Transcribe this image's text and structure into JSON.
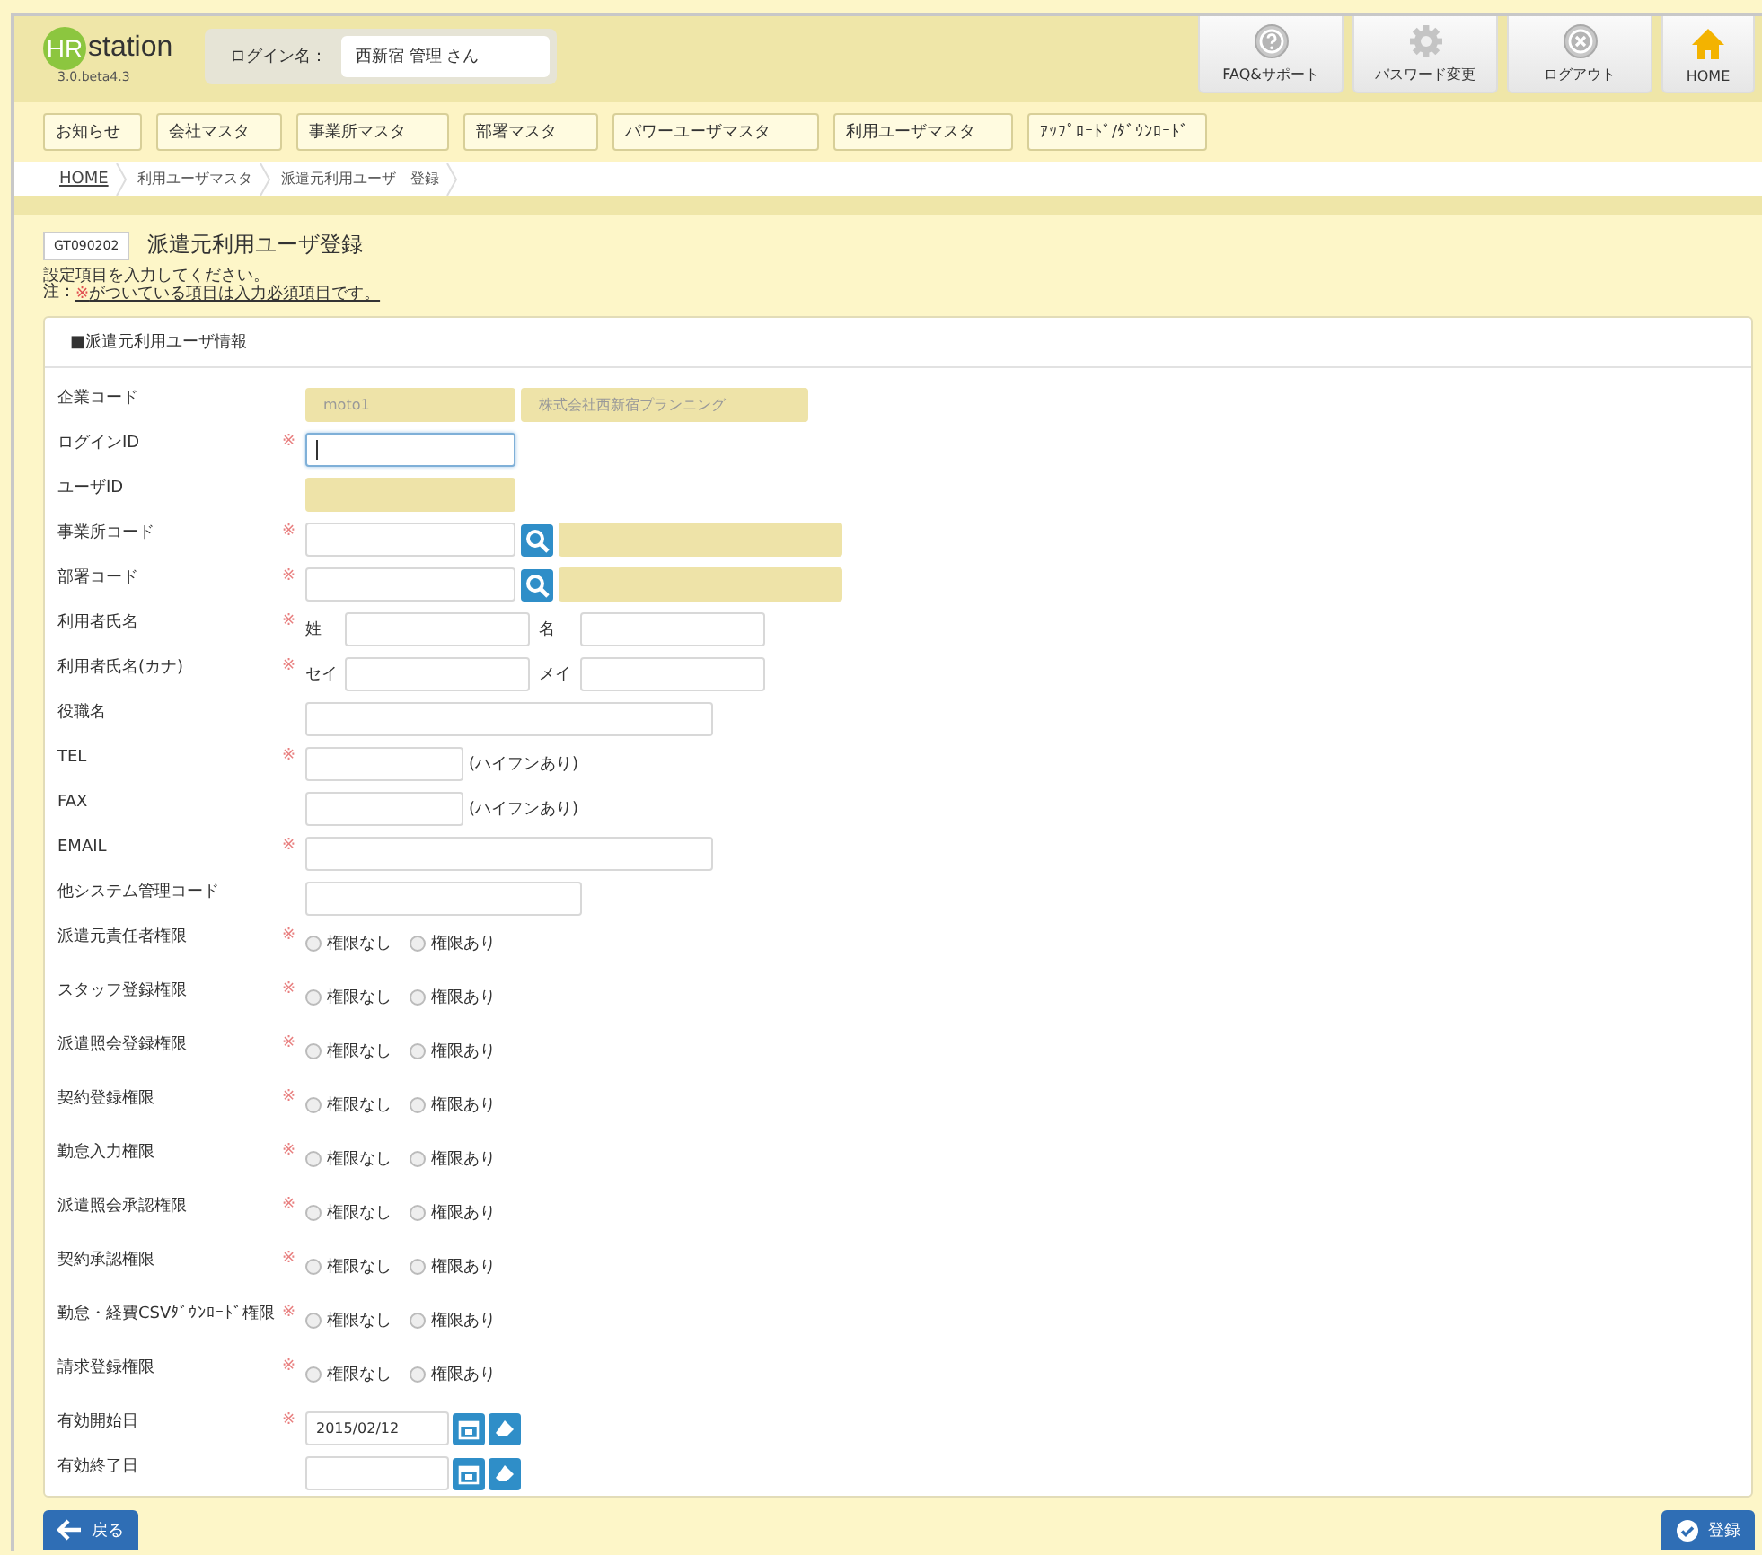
{
  "header": {
    "logo": {
      "mark": "HR",
      "name": "station",
      "version": "3.0.beta4.3"
    },
    "login_label": "ログイン名：",
    "login_user": "西新宿 管理 さん",
    "actions": [
      {
        "kind": "help",
        "label": "FAQ&サポート"
      },
      {
        "kind": "settings",
        "label": "パスワード変更"
      },
      {
        "kind": "logout",
        "label": "ログアウト"
      },
      {
        "kind": "home",
        "label": "HOME"
      }
    ]
  },
  "nav": [
    "お知らせ",
    "会社マスタ",
    "事業所マスタ",
    "部署マスタ",
    "パワーユーザマスタ",
    "利用ユーザマスタ",
    "ｱｯﾌﾟﾛｰﾄﾞ/ﾀﾞｳﾝﾛｰﾄﾞ"
  ],
  "breadcrumb": [
    {
      "label": "HOME",
      "link": true
    },
    {
      "label": "利用ユーザマスタ",
      "link": false
    },
    {
      "label": "派遣元利用ユーザ　登録",
      "link": false
    }
  ],
  "page": {
    "code": "GT090202",
    "title": "派遣元利用ユーザ登録",
    "instruction": "設定項目を入力してください。",
    "note_prefix": "注：",
    "note_mark": "※",
    "note": "がついている項目は入力必須項目です。"
  },
  "form": {
    "title": "■派遣元利用ユーザ情報",
    "required_mark": "※",
    "rows": [
      {
        "label": "企業コード",
        "required": false,
        "kind": "readonly-pair",
        "values": [
          "moto1",
          "株式会社西新宿プランニング"
        ]
      },
      {
        "label": "ログインID",
        "required": true,
        "kind": "input",
        "focused": true
      },
      {
        "label": "ユーザID",
        "required": false,
        "kind": "readonly"
      },
      {
        "label": "事業所コード",
        "required": true,
        "kind": "lookup"
      },
      {
        "label": "部署コード",
        "required": true,
        "kind": "lookup"
      },
      {
        "label": "利用者氏名",
        "required": true,
        "kind": "name",
        "parts": [
          "姓",
          "名"
        ]
      },
      {
        "label": "利用者氏名(カナ)",
        "required": true,
        "kind": "name",
        "parts": [
          "セイ",
          "メイ"
        ]
      },
      {
        "label": "役職名",
        "required": false,
        "kind": "wide"
      },
      {
        "label": "TEL",
        "required": true,
        "kind": "phone",
        "note": "(ハイフンあり)"
      },
      {
        "label": "FAX",
        "required": false,
        "kind": "phone",
        "note": "(ハイフンあり)"
      },
      {
        "label": "EMAIL",
        "required": true,
        "kind": "wide"
      },
      {
        "label": "他システム管理コード",
        "required": false,
        "kind": "medium"
      },
      {
        "label": "派遣元責任者権限",
        "required": true,
        "kind": "radio",
        "options": [
          {
            "label": "権限なし",
            "selected": false
          },
          {
            "label": "権限あり",
            "selected": false
          }
        ]
      },
      {
        "label": "スタッフ登録権限",
        "required": true,
        "kind": "radio",
        "options": [
          {
            "label": "権限なし",
            "selected": false
          },
          {
            "label": "権限あり",
            "selected": false
          }
        ]
      },
      {
        "label": "派遣照会登録権限",
        "required": true,
        "kind": "radio",
        "options": [
          {
            "label": "権限なし",
            "selected": false
          },
          {
            "label": "権限あり",
            "selected": false
          }
        ]
      },
      {
        "label": "契約登録権限",
        "required": true,
        "kind": "radio",
        "options": [
          {
            "label": "権限なし",
            "selected": false
          },
          {
            "label": "権限あり",
            "selected": false
          }
        ]
      },
      {
        "label": "勤怠入力権限",
        "required": true,
        "kind": "radio",
        "options": [
          {
            "label": "権限なし",
            "selected": false
          },
          {
            "label": "権限あり",
            "selected": false
          }
        ]
      },
      {
        "label": "派遣照会承認権限",
        "required": true,
        "kind": "radio",
        "options": [
          {
            "label": "権限なし",
            "selected": false
          },
          {
            "label": "権限あり",
            "selected": false
          }
        ]
      },
      {
        "label": "契約承認権限",
        "required": true,
        "kind": "radio",
        "options": [
          {
            "label": "権限なし",
            "selected": false
          },
          {
            "label": "権限あり",
            "selected": false
          }
        ]
      },
      {
        "label": "勤怠・経費CSVﾀﾞｳﾝﾛｰﾄﾞ権限",
        "required": true,
        "kind": "radio",
        "options": [
          {
            "label": "権限なし",
            "selected": false
          },
          {
            "label": "権限あり",
            "selected": false
          }
        ]
      },
      {
        "label": "請求登録権限",
        "required": true,
        "kind": "radio",
        "options": [
          {
            "label": "権限なし",
            "selected": false
          },
          {
            "label": "権限あり",
            "selected": false
          }
        ]
      },
      {
        "label": "有効開始日",
        "required": true,
        "kind": "date",
        "value": "2015/02/12"
      },
      {
        "label": "有効終了日",
        "required": false,
        "kind": "date"
      }
    ]
  },
  "footer": {
    "back": "戻る",
    "submit": "登録"
  }
}
